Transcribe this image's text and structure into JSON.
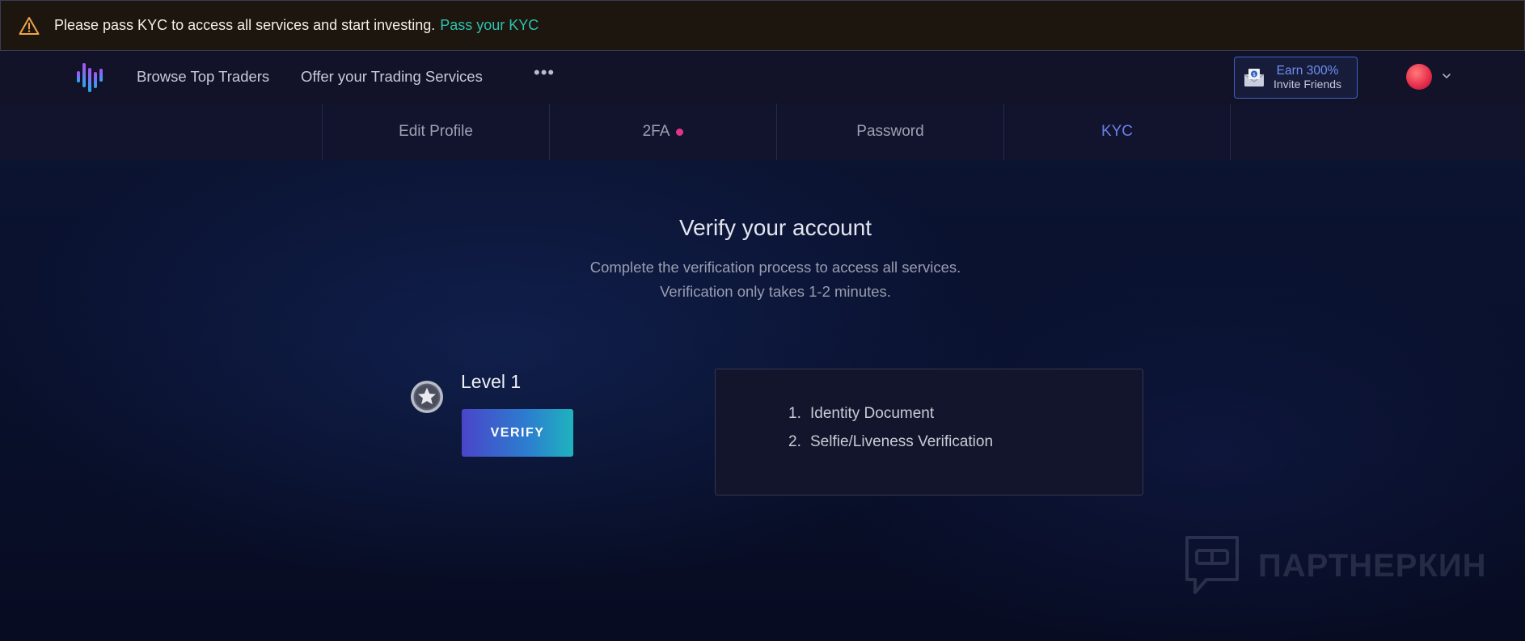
{
  "banner": {
    "message": "Please pass KYC to access all services and start investing.",
    "link_label": "Pass your KYC",
    "icon": "warning-triangle-icon"
  },
  "header": {
    "nav": [
      {
        "label": "Browse Top Traders"
      },
      {
        "label": "Offer your Trading Services"
      }
    ],
    "more_label": "•••",
    "earn": {
      "title": "Earn 300%",
      "subtitle": "Invite Friends",
      "icon": "envelope-dollar-icon"
    },
    "avatar_icon": "avatar",
    "chevron_icon": "chevron-down-icon"
  },
  "tabs": [
    {
      "label": "Edit Profile",
      "active": false
    },
    {
      "label": "2FA",
      "active": false,
      "alert_dot": true
    },
    {
      "label": "Password",
      "active": false
    },
    {
      "label": "KYC",
      "active": true
    }
  ],
  "main": {
    "title": "Verify your account",
    "subtitle_line1": "Complete the verification process to access all services.",
    "subtitle_line2": "Verification only takes 1-2 minutes."
  },
  "level": {
    "title": "Level 1",
    "button_label": "VERIFY",
    "badge_icon": "star-badge-icon",
    "steps": [
      {
        "num": "1.",
        "label": "Identity Document"
      },
      {
        "num": "2.",
        "label": "Selfie/Liveness Verification"
      }
    ]
  },
  "watermark": {
    "text": "ПАРТНЕРКИН"
  },
  "colors": {
    "accent": "#6a7ff0",
    "link": "#2cc3b0",
    "warning": "#f0a44a",
    "alert_dot": "#e1358a"
  }
}
